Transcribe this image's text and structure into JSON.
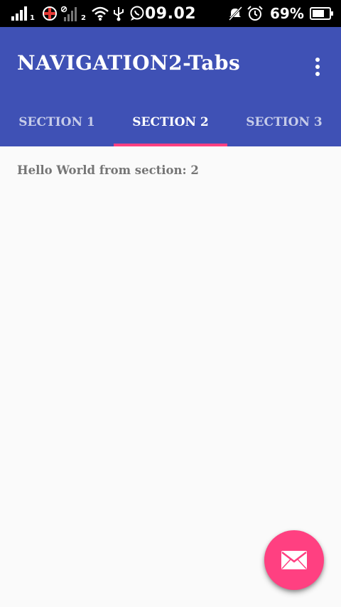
{
  "status_bar": {
    "sim1_label": "1",
    "sim2_label": "2",
    "time": "09.02",
    "battery_percent": "69%",
    "icons": [
      "signal-icon",
      "no-network-icon",
      "wifi-icon",
      "usb-icon",
      "whatsapp-icon",
      "mute-icon",
      "alarm-icon",
      "battery-icon"
    ]
  },
  "app_bar": {
    "title": "NAVIGATION2-Tabs",
    "menu_icon": "more-vert-icon",
    "color": "#3f51b5"
  },
  "tabs": [
    {
      "label": "SECTION 1",
      "selected": false
    },
    {
      "label": "SECTION 2",
      "selected": true
    },
    {
      "label": "SECTION 3",
      "selected": false
    }
  ],
  "accent_color": "#ff4081",
  "content": {
    "text": "Hello World from section: 2"
  },
  "fab": {
    "icon": "email-icon"
  }
}
